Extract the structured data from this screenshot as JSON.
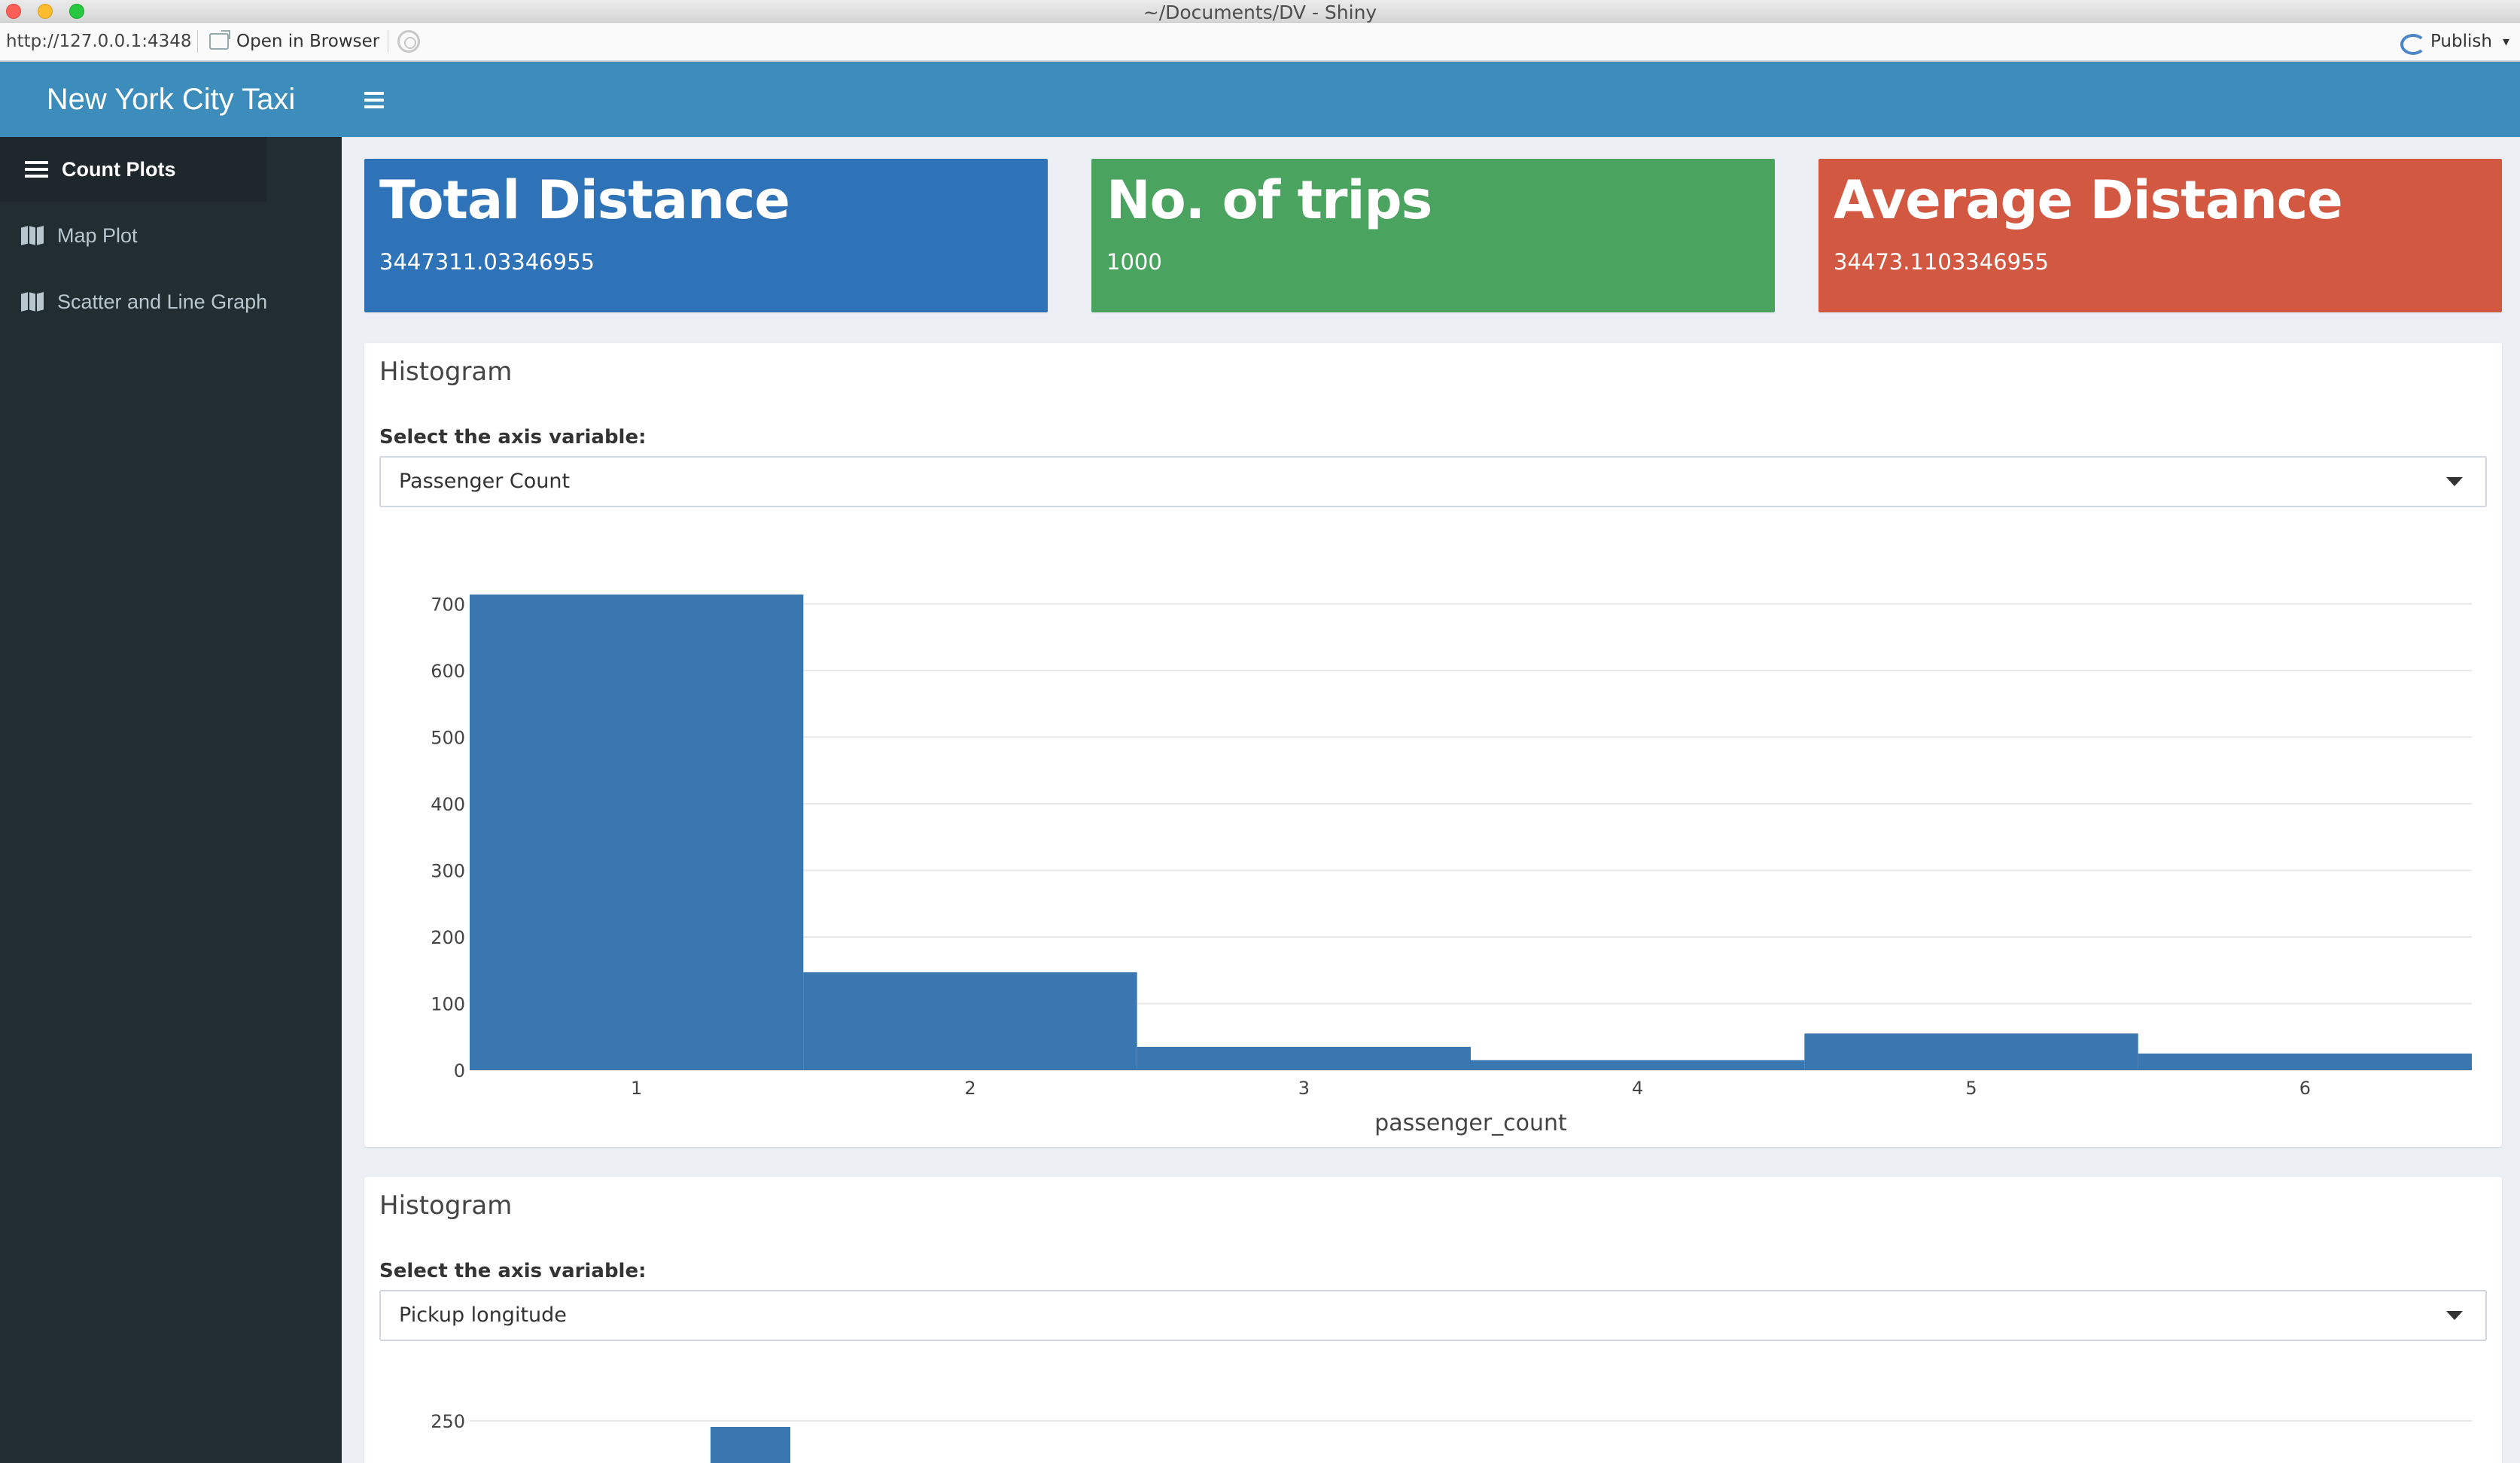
{
  "window": {
    "title": "~/Documents/DV - Shiny"
  },
  "viewer": {
    "url": "http://127.0.0.1:4348",
    "open_browser_label": "Open in Browser",
    "publish_label": "Publish"
  },
  "app": {
    "title": "New York City Taxi"
  },
  "sidebar": {
    "items": [
      {
        "label": "Count Plots",
        "icon": "list-icon",
        "active": true
      },
      {
        "label": "Map Plot",
        "icon": "map-icon",
        "active": false
      },
      {
        "label": "Scatter and Line Graph",
        "icon": "map-icon",
        "active": false
      }
    ]
  },
  "value_boxes": [
    {
      "title": "Total Distance",
      "value": "3447311.03346955",
      "color": "#2e73b7"
    },
    {
      "title": "No. of trips",
      "value": "1000",
      "color": "#4aa35e"
    },
    {
      "title": "Average Distance",
      "value": "34473.1103346955",
      "color": "#d35842"
    }
  ],
  "histogram1": {
    "box_title": "Histogram",
    "select_label": "Select the axis variable:",
    "select_value": "Passenger Count"
  },
  "histogram2": {
    "box_title": "Histogram",
    "select_label": "Select the axis variable:",
    "select_value": "Pickup longitude"
  },
  "chart_data": [
    {
      "type": "bar",
      "categories": [
        "1",
        "2",
        "3",
        "4",
        "5",
        "6"
      ],
      "values": [
        714,
        147,
        35,
        15,
        55,
        25
      ],
      "xlabel": "passenger_count",
      "ylabel": "",
      "ylim": [
        0,
        714
      ],
      "yticks": [
        0,
        100,
        200,
        300,
        400,
        500,
        600,
        700
      ],
      "bar_color": "#3a76b0",
      "grid": true
    },
    {
      "type": "bar",
      "visible_ytick": "250",
      "bar_color": "#3a76b0",
      "grid": true
    }
  ]
}
